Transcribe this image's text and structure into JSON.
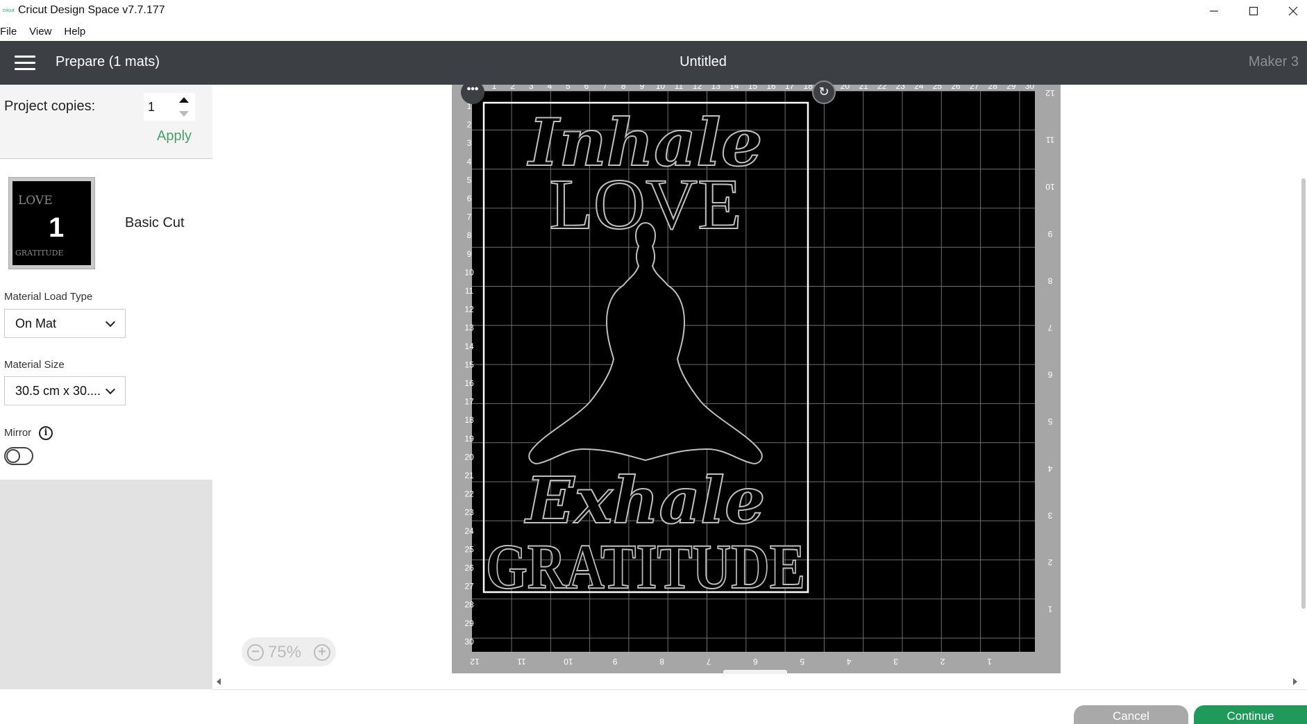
{
  "window": {
    "logo_text": "cricut",
    "title": "Cricut Design Space  v7.7.177",
    "controls": {
      "minimize": "minimize-icon",
      "maximize": "maximize-icon",
      "close": "close-icon"
    }
  },
  "menu": {
    "items": [
      "File",
      "View",
      "Help"
    ]
  },
  "header": {
    "page_title": "Prepare (1 mats)",
    "project_name": "Untitled",
    "machine": "Maker 3"
  },
  "sidebar": {
    "copies_label": "Project copies:",
    "copies_value": "1",
    "apply_label": "Apply",
    "mat": {
      "number": "1",
      "thumb_text_top": "LOVE",
      "thumb_text_bottom": "GRATITUDE",
      "name": "Basic Cut"
    },
    "load_type_label": "Material Load Type",
    "load_type_value": "On Mat",
    "size_label": "Material Size",
    "size_value": "30.5 cm x 30....",
    "mirror_label": "Mirror",
    "mirror_on": false
  },
  "canvas": {
    "zoom": "75%",
    "ruler_top": [
      1,
      2,
      3,
      4,
      5,
      6,
      7,
      8,
      9,
      10,
      11,
      12,
      13,
      14,
      15,
      16,
      17,
      18,
      19,
      20,
      21,
      22,
      23,
      24,
      25,
      26,
      27,
      28,
      29,
      30
    ],
    "ruler_left": [
      1,
      2,
      3,
      4,
      5,
      6,
      7,
      8,
      9,
      10,
      11,
      12,
      13,
      14,
      15,
      16,
      17,
      18,
      19,
      20,
      21,
      22,
      23,
      24,
      25,
      26,
      27,
      28,
      29,
      30
    ],
    "ruler_bottom": [
      12,
      11,
      10,
      9,
      8,
      7,
      6,
      5,
      4,
      3,
      2,
      1
    ],
    "ruler_right": [
      12,
      11,
      10,
      9,
      8,
      7,
      6,
      5,
      4,
      3,
      2,
      1
    ],
    "design_text": {
      "line1": "Inhale",
      "line2": "LOVE",
      "line3": "Exhale",
      "line4": "GRATITUDE"
    }
  },
  "footer": {
    "cancel_label": "Cancel",
    "continue_label": "Continue"
  },
  "colors": {
    "header_bg": "#3c3f44",
    "accent_green": "#1f9a5a",
    "apply_green": "#45a164"
  }
}
